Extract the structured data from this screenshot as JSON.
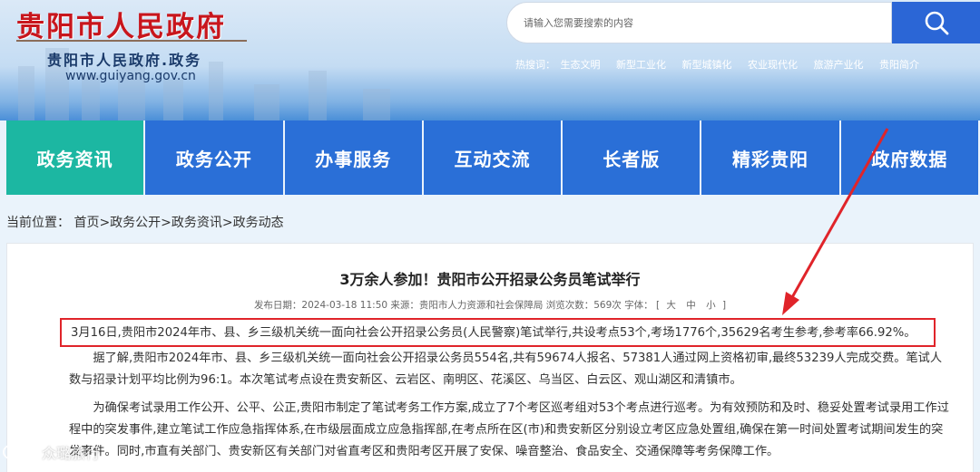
{
  "header": {
    "logo_cn": "贵阳市人民政府",
    "logo_sub": "贵阳市人民政府.政务",
    "logo_url": "www.guiyang.gov.cn",
    "search_placeholder": "请输入您需要搜索的内容",
    "hot_label": "热搜词：",
    "hot_items": [
      "生态文明",
      "新型工业化",
      "新型城镇化",
      "农业现代化",
      "旅游产业化",
      "贵阳简介"
    ]
  },
  "nav": {
    "items": [
      "政务资讯",
      "政务公开",
      "办事服务",
      "互动交流",
      "长者版",
      "精彩贵阳",
      "政府数据"
    ],
    "active_index": 0
  },
  "breadcrumb": "当前位置： 首页>政务公开>政务资讯>政务动态",
  "article": {
    "title": "3万余人参加！贵阳市公开招录公务员笔试举行",
    "meta_prefix": "发布日期：2024-03-18 11:50 来源：贵阳市人力资源和社会保障局 浏览次数：569次 字体：",
    "font_bracket_open": "[",
    "font_large": "大",
    "font_medium": "中",
    "font_small": "小",
    "font_bracket_close": "]",
    "para1": "3月16日,贵阳市2024年市、县、乡三级机关统一面向社会公开招录公务员(人民警察)笔试举行,共设考点53个,考场1776个,35629名考生参考,参考率66.92%。",
    "para2": "据了解,贵阳市2024年市、县、乡三级机关统一面向社会公开招录公务员554名,共有59674人报名、57381人通过网上资格初审,最终53239人完成交费。笔试人数与招录计划平均比例为96:1。本次笔试考点设在贵安新区、云岩区、南明区、花溪区、乌当区、白云区、观山湖区和清镇市。",
    "para3": "为确保考试录用工作公开、公平、公正,贵阳市制定了笔试考务工作方案,成立了7个考区巡考组对53个考点进行巡考。为有效预防和及时、稳妥处置考试录用工作过程中的突发事件,建立笔试工作应急指挥体系,在市级层面成立应急指挥部,在考点所在区(市)和贵安新区分别设立考区应急处置组,确保在第一时间处置考试期间发生的突发事件。同时,市直有关部门、贵安新区有关部门对省直考区和贵阳考区开展了安保、噪音整治、食品安全、交通保障等考务保障工作。"
  },
  "watermark": "众璐旅行",
  "colors": {
    "nav_blue": "#2a6fd7",
    "nav_active": "#1cb7a2",
    "search_button": "#2b66d6",
    "logo_red": "#c8161d",
    "annotation_red": "#e0242a"
  }
}
